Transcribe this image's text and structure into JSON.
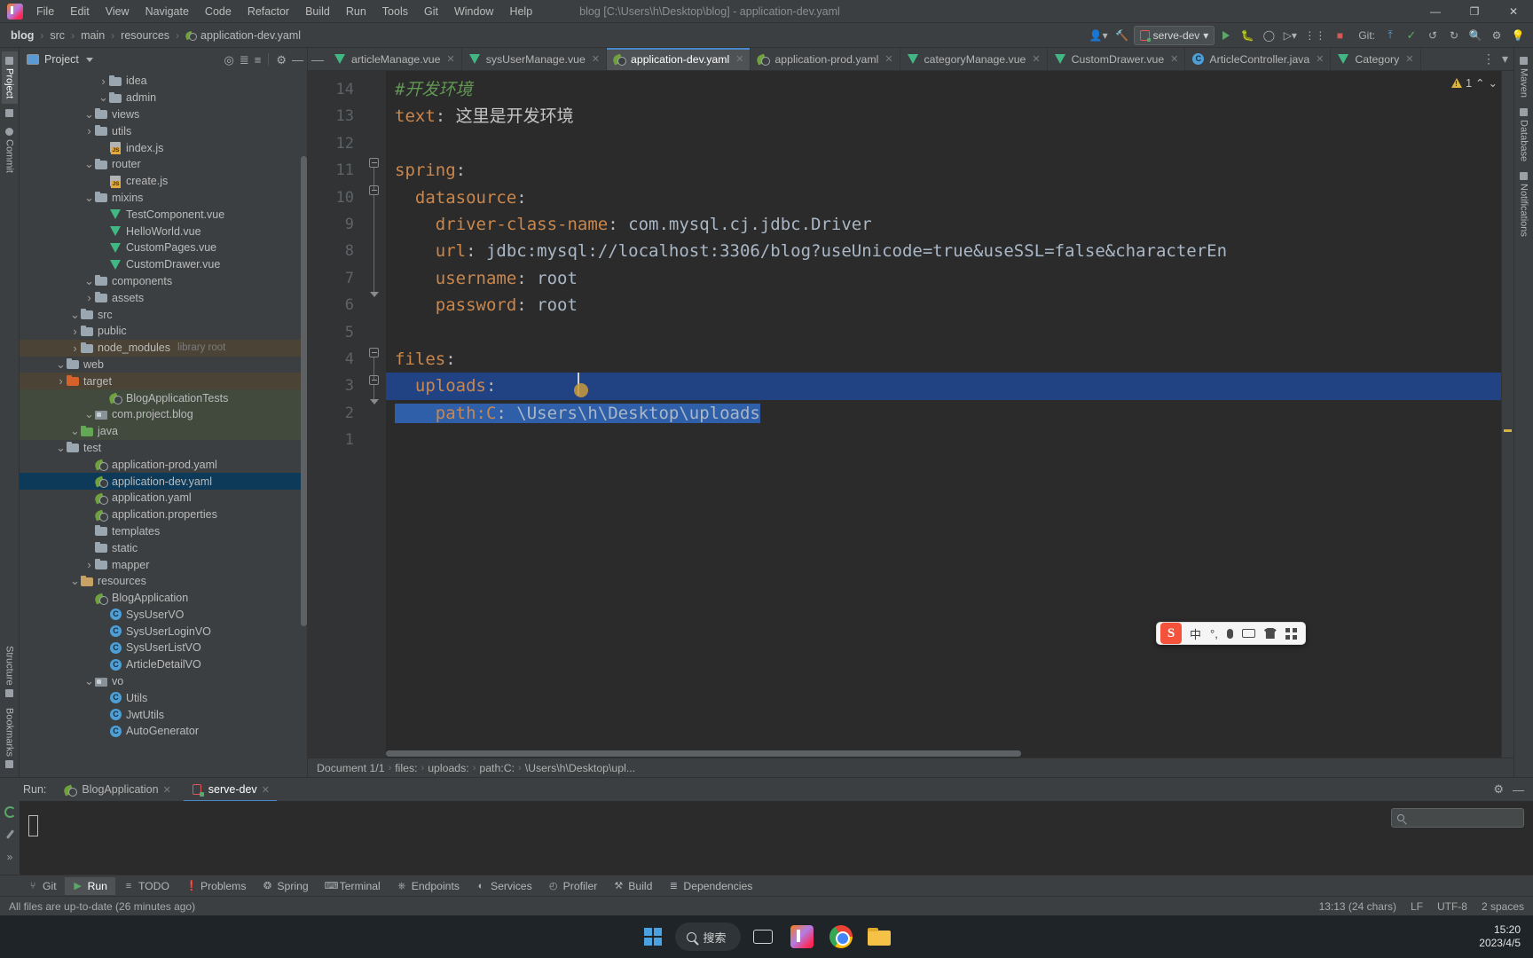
{
  "titlebar": {
    "menus": [
      "File",
      "Edit",
      "View",
      "Navigate",
      "Code",
      "Refactor",
      "Build",
      "Run",
      "Tools",
      "Git",
      "Window",
      "Help"
    ],
    "title": "blog [C:\\Users\\h\\Desktop\\blog] - application-dev.yaml",
    "minimize": "—",
    "maximize": "❐",
    "close": "✕"
  },
  "breadcrumb_top": {
    "items": [
      "blog",
      "src",
      "main",
      "resources"
    ],
    "file": "application-dev.yaml",
    "separator": "›"
  },
  "toolbar": {
    "user_icon": "user-icon",
    "hammer_icon": "build-icon",
    "run_config": "serve-dev",
    "run_icon": "run-icon",
    "debug_icon": "debug-icon",
    "profile_icon": "profile-icon",
    "more_icon": "▾",
    "coverage_icon": "coverage-icon",
    "stop_icon": "stop-icon",
    "git_label": "Git:",
    "git_update": "update-icon",
    "git_commit": "commit-icon",
    "git_history": "history-icon",
    "git_rollback": "rollback-icon",
    "search_icon": "search-icon",
    "settings_icon": "gear-icon",
    "bulb_icon": "bulb-icon"
  },
  "left_strip": {
    "tabs": [
      {
        "label": "Project",
        "icon": "project-icon",
        "active": true
      },
      {
        "label": "",
        "icon": "folder-icon",
        "active": false
      },
      {
        "label": "Commit",
        "icon": "commit-icon",
        "active": false
      }
    ],
    "bottom_tabs": [
      {
        "label": "Structure",
        "icon": "structure-icon"
      },
      {
        "label": "Bookmarks",
        "icon": "bookmark-icon"
      }
    ]
  },
  "right_strip": {
    "tabs": [
      "Maven",
      "Database",
      "Notifications"
    ]
  },
  "project_panel": {
    "title": "Project",
    "tools": [
      "locate-icon",
      "collapse-all-icon",
      "expand-icon",
      "gear-icon",
      "hide-icon"
    ],
    "tree": [
      {
        "label": "AutoGenerator",
        "indent": 5,
        "icon": "java-class",
        "twist": ""
      },
      {
        "label": "JwtUtils",
        "indent": 5,
        "icon": "java-class",
        "twist": ""
      },
      {
        "label": "Utils",
        "indent": 5,
        "icon": "java-class",
        "twist": ""
      },
      {
        "label": "vo",
        "indent": 4,
        "icon": "package",
        "twist": "⌄"
      },
      {
        "label": "ArticleDetailVO",
        "indent": 5,
        "icon": "java-class",
        "twist": ""
      },
      {
        "label": "SysUserListVO",
        "indent": 5,
        "icon": "java-class",
        "twist": ""
      },
      {
        "label": "SysUserLoginVO",
        "indent": 5,
        "icon": "java-class",
        "twist": ""
      },
      {
        "label": "SysUserVO",
        "indent": 5,
        "icon": "java-class",
        "twist": ""
      },
      {
        "label": "BlogApplication",
        "indent": 4,
        "icon": "spring-class",
        "twist": ""
      },
      {
        "label": "resources",
        "indent": 3,
        "icon": "res-folder",
        "twist": "⌄"
      },
      {
        "label": "mapper",
        "indent": 4,
        "icon": "folder",
        "twist": "›"
      },
      {
        "label": "static",
        "indent": 4,
        "icon": "folder",
        "twist": ""
      },
      {
        "label": "templates",
        "indent": 4,
        "icon": "folder",
        "twist": ""
      },
      {
        "label": "application.properties",
        "indent": 4,
        "icon": "props",
        "twist": ""
      },
      {
        "label": "application.yaml",
        "indent": 4,
        "icon": "props",
        "twist": ""
      },
      {
        "label": "application-dev.yaml",
        "indent": 4,
        "icon": "props",
        "twist": "",
        "selected": true
      },
      {
        "label": "application-prod.yaml",
        "indent": 4,
        "icon": "props",
        "twist": ""
      },
      {
        "label": "test",
        "indent": 2,
        "icon": "folder",
        "twist": "⌄"
      },
      {
        "label": "java",
        "indent": 3,
        "icon": "green-folder",
        "twist": "⌄",
        "row": "testroot"
      },
      {
        "label": "com.project.blog",
        "indent": 4,
        "icon": "package",
        "twist": "⌄",
        "row": "testroot"
      },
      {
        "label": "BlogApplicationTests",
        "indent": 5,
        "icon": "spring-class",
        "twist": "",
        "row": "testroot"
      },
      {
        "label": "target",
        "indent": 2,
        "icon": "orange-folder",
        "twist": "›",
        "row": "excluded"
      },
      {
        "label": "web",
        "indent": 2,
        "icon": "folder",
        "twist": "⌄"
      },
      {
        "label": "node_modules",
        "indent": 3,
        "icon": "folder",
        "twist": "›",
        "row": "excluded",
        "tag": "library root"
      },
      {
        "label": "public",
        "indent": 3,
        "icon": "folder",
        "twist": "›"
      },
      {
        "label": "src",
        "indent": 3,
        "icon": "folder",
        "twist": "⌄"
      },
      {
        "label": "assets",
        "indent": 4,
        "icon": "folder",
        "twist": "›"
      },
      {
        "label": "components",
        "indent": 4,
        "icon": "folder",
        "twist": "⌄"
      },
      {
        "label": "CustomDrawer.vue",
        "indent": 5,
        "icon": "vue",
        "twist": ""
      },
      {
        "label": "CustomPages.vue",
        "indent": 5,
        "icon": "vue",
        "twist": ""
      },
      {
        "label": "HelloWorld.vue",
        "indent": 5,
        "icon": "vue",
        "twist": ""
      },
      {
        "label": "TestComponent.vue",
        "indent": 5,
        "icon": "vue",
        "twist": ""
      },
      {
        "label": "mixins",
        "indent": 4,
        "icon": "folder",
        "twist": "⌄"
      },
      {
        "label": "create.js",
        "indent": 5,
        "icon": "js",
        "twist": ""
      },
      {
        "label": "router",
        "indent": 4,
        "icon": "folder",
        "twist": "⌄"
      },
      {
        "label": "index.js",
        "indent": 5,
        "icon": "js",
        "twist": ""
      },
      {
        "label": "utils",
        "indent": 4,
        "icon": "folder",
        "twist": "›"
      },
      {
        "label": "views",
        "indent": 4,
        "icon": "folder",
        "twist": "⌄"
      },
      {
        "label": "admin",
        "indent": 5,
        "icon": "folder",
        "twist": "⌄"
      },
      {
        "label": "idea",
        "indent": 5,
        "icon": "folder",
        "twist": "›"
      }
    ]
  },
  "editor_tabs": [
    {
      "label": "articleManage.vue",
      "icon": "vue",
      "active": false,
      "close": "✕"
    },
    {
      "label": "sysUserManage.vue",
      "icon": "vue",
      "active": false,
      "close": "✕"
    },
    {
      "label": "application-dev.yaml",
      "icon": "props",
      "active": true,
      "close": "✕"
    },
    {
      "label": "application-prod.yaml",
      "icon": "props",
      "active": false,
      "close": "✕"
    },
    {
      "label": "categoryManage.vue",
      "icon": "vue",
      "active": false,
      "close": "✕"
    },
    {
      "label": "CustomDrawer.vue",
      "icon": "vue",
      "active": false,
      "close": "✕"
    },
    {
      "label": "ArticleController.java",
      "icon": "java-class",
      "active": false,
      "close": "✕"
    },
    {
      "label": "Category",
      "icon": "vue",
      "active": false,
      "close": "✕"
    }
  ],
  "editor": {
    "line_numbers": [
      "1",
      "2",
      "3",
      "4",
      "5",
      "6",
      "7",
      "8",
      "9",
      "10",
      "11",
      "12",
      "13",
      "14"
    ],
    "lines": [
      {
        "n": 1,
        "text": "#开发环境",
        "type": "comment"
      },
      {
        "n": 2,
        "key": "text",
        "value": "这里是开发环境",
        "indent": 0,
        "type": "kv-cjk"
      },
      {
        "n": 3,
        "text": "",
        "type": "blank"
      },
      {
        "n": 4,
        "key": "spring",
        "value": "",
        "indent": 0,
        "type": "key"
      },
      {
        "n": 5,
        "key": "datasource",
        "value": "",
        "indent": 1,
        "type": "key"
      },
      {
        "n": 6,
        "key": "driver-class-name",
        "value": "com.mysql.cj.jdbc.Driver",
        "indent": 2,
        "type": "kv"
      },
      {
        "n": 7,
        "key": "url",
        "value": "jdbc:mysql://localhost:3306/blog?useUnicode=true&useSSL=false&characterEn",
        "indent": 2,
        "type": "kv"
      },
      {
        "n": 8,
        "key": "username",
        "value": "root",
        "indent": 2,
        "type": "kv"
      },
      {
        "n": 9,
        "key": "password",
        "value": "root",
        "indent": 2,
        "type": "kv"
      },
      {
        "n": 10,
        "text": "",
        "type": "blank"
      },
      {
        "n": 11,
        "key": "files",
        "value": "",
        "indent": 0,
        "type": "key"
      },
      {
        "n": 12,
        "key": "uploads",
        "value": "",
        "indent": 1,
        "type": "key",
        "highlight": true
      },
      {
        "n": 13,
        "key": "path:C",
        "value": "\\Users\\h\\Desktop\\uploads",
        "indent": 2,
        "type": "kv",
        "selected": true
      },
      {
        "n": 14,
        "text": "",
        "type": "blank"
      }
    ],
    "warning_count": "1",
    "warning_icon": "warning-triangle-icon",
    "inspection_up": "⌃",
    "inspection_down": "⌄"
  },
  "editor_breadcrumb": {
    "items": [
      "Document 1/1",
      "files:",
      "uploads:",
      "path:C:",
      "\\Users\\h\\Desktop\\upl..."
    ],
    "separator": "›"
  },
  "run_window": {
    "label": "Run:",
    "tabs": [
      {
        "label": "BlogApplication",
        "icon": "spring-class",
        "active": false,
        "close": "✕"
      },
      {
        "label": "serve-dev",
        "icon": "npm-run",
        "active": true,
        "close": "✕"
      }
    ],
    "side_buttons": [
      "rerun-icon",
      "wrench-icon",
      "more-icon"
    ],
    "more_label": "»",
    "settings_icon": "gear-icon",
    "hide_icon": "—",
    "search_placeholder": ""
  },
  "bottom_tabs": [
    {
      "label": "Git",
      "icon": "git-icon",
      "active": false
    },
    {
      "label": "Run",
      "icon": "run-icon",
      "active": true
    },
    {
      "label": "TODO",
      "icon": "todo-icon",
      "active": false
    },
    {
      "label": "Problems",
      "icon": "problems-icon",
      "active": false
    },
    {
      "label": "Spring",
      "icon": "spring-icon",
      "active": false
    },
    {
      "label": "Terminal",
      "icon": "terminal-icon",
      "active": false
    },
    {
      "label": "Endpoints",
      "icon": "endpoints-icon",
      "active": false
    },
    {
      "label": "Services",
      "icon": "services-icon",
      "active": false
    },
    {
      "label": "Profiler",
      "icon": "profiler-icon",
      "active": false
    },
    {
      "label": "Build",
      "icon": "build-icon",
      "active": false
    },
    {
      "label": "Dependencies",
      "icon": "dependencies-icon",
      "active": false
    }
  ],
  "statusbar": {
    "message": "All files are up-to-date (26 minutes ago)",
    "caret": "13:13 (24 chars)",
    "line_sep": "LF",
    "encoding": "UTF-8",
    "indent": "2 spaces"
  },
  "ime_bar": {
    "logo": "sogou-icon",
    "lang": "中",
    "punct": "°,",
    "mic": "mic-icon",
    "keyboard": "keyboard-icon",
    "skin": "skin-icon",
    "apps": "apps-icon"
  },
  "taskbar": {
    "start_icon": "windows-start-icon",
    "search_text": "搜索",
    "taskview_icon": "task-view-icon",
    "idea_icon": "intellij-idea-icon",
    "chrome_icon": "chrome-icon",
    "explorer_icon": "file-explorer-icon",
    "time": "15:20",
    "date": "2023/4/5"
  }
}
